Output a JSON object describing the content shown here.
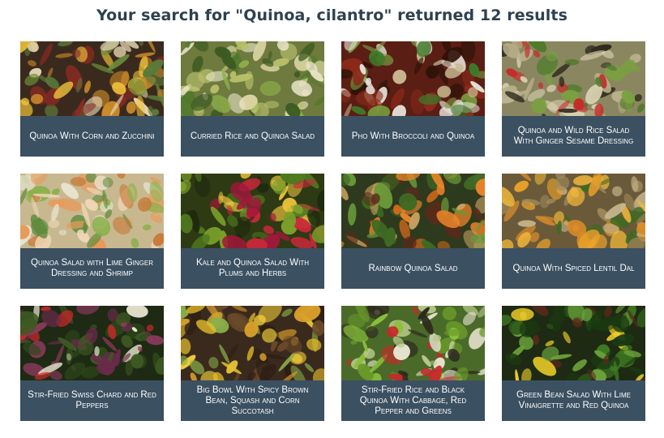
{
  "search": {
    "heading": "Your search for \"Quinoa, cilantro\" returned 12 results"
  },
  "results": [
    {
      "title": "Quinoa With Corn and Zucchini",
      "photo": {
        "base": "#3a2a1e",
        "colors": [
          "#c98a2a",
          "#f2c53a",
          "#6d8f3a",
          "#8a2a22",
          "#e8d9b5",
          "#5a7a3a"
        ]
      }
    },
    {
      "title": "Curried Rice and Quinoa Salad",
      "photo": {
        "base": "#6e7a3e",
        "colors": [
          "#d8d2a0",
          "#8fb04a",
          "#4e7a2a",
          "#e8e4c8",
          "#b8c06a",
          "#3c5a22"
        ]
      }
    },
    {
      "title": "Pho With Broccoli and Quinoa",
      "photo": {
        "base": "#5a1e14",
        "colors": [
          "#8a2a1a",
          "#3e7a2a",
          "#e8e4dc",
          "#c8b890",
          "#2e1208",
          "#7aa040"
        ]
      }
    },
    {
      "title": "Quinoa and Wild Rice Salad With Ginger Sesame Dressing",
      "photo": {
        "base": "#8a8660",
        "colors": [
          "#d8d0b0",
          "#4e7a2a",
          "#c82a2a",
          "#2e2a1e",
          "#b8b08a",
          "#7aa040"
        ]
      }
    },
    {
      "title": "Quinoa Salad with Lime Ginger Dressing and Shrimp",
      "photo": {
        "base": "#c8b890",
        "colors": [
          "#e89a5a",
          "#f2d8b8",
          "#5a8a3a",
          "#e8e4d0",
          "#c87a3a",
          "#8ab04a"
        ]
      }
    },
    {
      "title": "Kale and Quinoa Salad With Plums and Herbs",
      "photo": {
        "base": "#2e3a14",
        "colors": [
          "#c8283a",
          "#4e7a1e",
          "#e8c03a",
          "#1e2a0e",
          "#7aa02a",
          "#a0183a"
        ]
      }
    },
    {
      "title": "Rainbow Quinoa Salad",
      "photo": {
        "base": "#2e3a1e",
        "colors": [
          "#e8842a",
          "#3e6a22",
          "#c8a060",
          "#5a2a1a",
          "#6a9a3a",
          "#d86a1a"
        ]
      }
    },
    {
      "title": "Quinoa With Spiced Lentil Dal",
      "photo": {
        "base": "#6a5a3a",
        "colors": [
          "#e8a02a",
          "#c8b890",
          "#3e6a22",
          "#d88a2a",
          "#a08a5a",
          "#f2b83a"
        ]
      }
    },
    {
      "title": "Stir-Fried Swiss Chard and Red Peppers",
      "photo": {
        "base": "#1e2a14",
        "colors": [
          "#3e5a22",
          "#c8282a",
          "#6a2a4a",
          "#2e4a1a",
          "#e8e4d0",
          "#8a3a5a"
        ]
      }
    },
    {
      "title": "Big Bowl With Spicy Brown Bean, Squash and Corn Succotash",
      "photo": {
        "base": "#3a2a1e",
        "colors": [
          "#f2d03a",
          "#6a4a2a",
          "#e8c02a",
          "#2e1e14",
          "#8ab04a",
          "#d8a02a"
        ]
      }
    },
    {
      "title": "Stir-Fried Rice and Black Quinoa With Cabbage, Red Pepper and Greens",
      "photo": {
        "base": "#4a6a2a",
        "colors": [
          "#8ac03a",
          "#e8e4d0",
          "#c8282a",
          "#2e2a1e",
          "#b8c88a",
          "#6a9a2a"
        ]
      }
    },
    {
      "title": "Green Bean Salad With Lime Vinaigrette and Red Quinoa",
      "photo": {
        "base": "#1e2a14",
        "colors": [
          "#3e7a22",
          "#f2d02a",
          "#2e5a1a",
          "#5a2a1a",
          "#6aa03a",
          "#1a3a10"
        ]
      }
    }
  ]
}
